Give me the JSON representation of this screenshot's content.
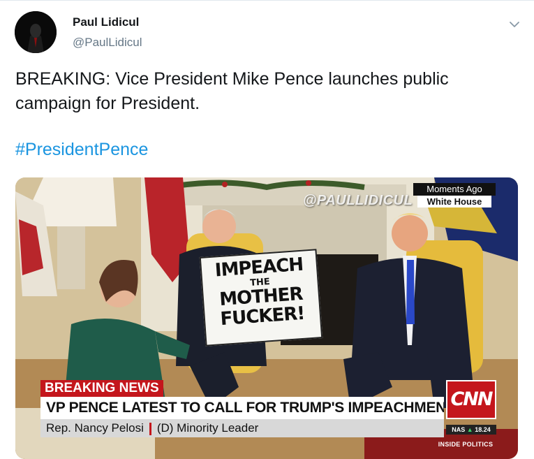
{
  "tweet": {
    "author_name": "Paul Lidicul",
    "author_handle": "@PaulLidicul",
    "text": "BREAKING: Vice President Mike Pence launches public campaign for President.",
    "hashtag": "#PresidentPence"
  },
  "media": {
    "watermark": "@PAULLIDICUL",
    "time_label": "Moments Ago",
    "location_label": "White House",
    "sign": {
      "line1": "IMPEACH",
      "line2": "THE",
      "line3": "MOTHER",
      "line4": "FUCKER!"
    },
    "breaking_tag": "BREAKING NEWS",
    "headline": "VP PENCE LATEST TO CALL FOR TRUMP'S IMPEACHMENT",
    "subline_name": "Rep. Nancy Pelosi",
    "subline_title": "(D) Minority Leader",
    "network_logo": "CNN",
    "ticker_symbol": "NAS",
    "ticker_arrow": "▲",
    "ticker_value": "18.24",
    "program": "INSIDE POLITICS"
  },
  "colors": {
    "link": "#1b95e0",
    "cnn_red": "#c4161c"
  },
  "icons": {
    "menu": "chevron-down-icon"
  }
}
